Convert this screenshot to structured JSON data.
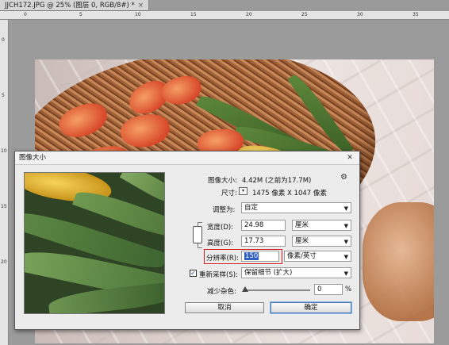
{
  "document": {
    "tab_title": "JJCH172.JPG @ 25% (图层 0, RGB/8#) *",
    "close_glyph": "×"
  },
  "ruler": {
    "top_numbers": [
      "0",
      "5",
      "10",
      "15",
      "20",
      "25",
      "30",
      "35"
    ],
    "left_numbers": [
      "0",
      "5",
      "10",
      "15",
      "20"
    ]
  },
  "dialog": {
    "title": "图像大小",
    "close_glyph": "✕",
    "image_size_label": "图像大小:",
    "image_size_value": "4.42M (之前为17.7M)",
    "dimensions_label": "尺寸:",
    "dimensions_value": "1475 像素  X  1047 像素",
    "fit_to_label": "调整为:",
    "fit_to_value": "自定",
    "width_label": "宽度(D):",
    "width_value": "24.98",
    "width_unit": "厘米",
    "height_label": "高度(G):",
    "height_value": "17.73",
    "height_unit": "厘米",
    "resolution_label": "分辨率(R):",
    "resolution_value": "150",
    "resolution_unit": "像素/英寸",
    "resample_checked": true,
    "resample_label": "重新采样(S):",
    "resample_value": "保留细节 (扩大)",
    "noise_label": "减少杂色:",
    "noise_value": "0",
    "noise_unit": "%",
    "noise_level": 0,
    "cancel_label": "取消",
    "ok_label": "确定"
  }
}
